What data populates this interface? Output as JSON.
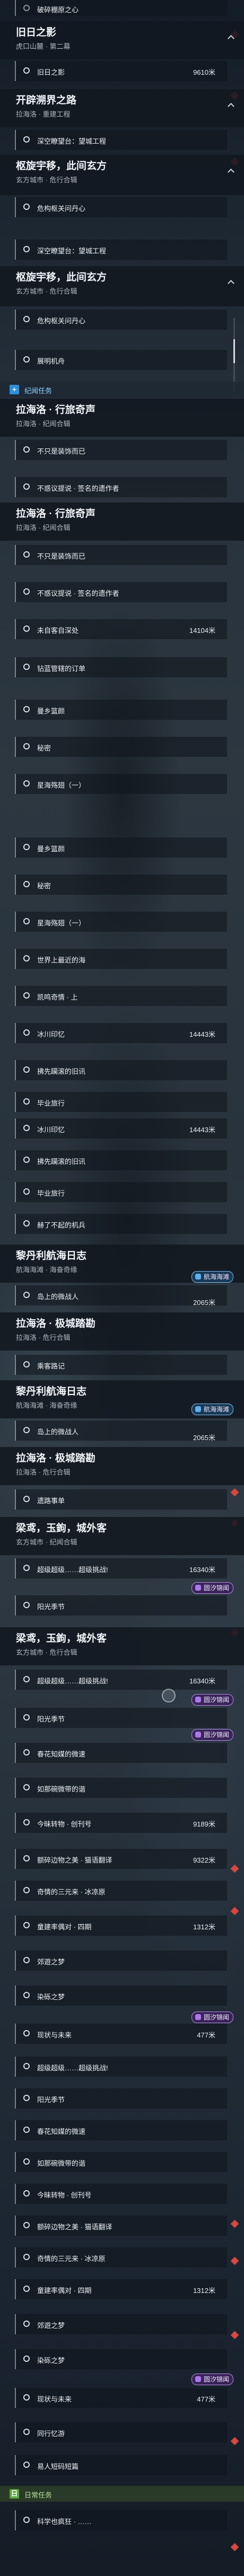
{
  "colors": {
    "accent_red": "#d9473f",
    "tag_blue": "#2e8fd8",
    "tag_green": "#59a43a",
    "badge_purple": "#b48be6"
  },
  "s1": {
    "item0": "破碎棚原之心"
  },
  "s2": {
    "title": "旧日之影",
    "sub": "虎口山麓 · 第二幕",
    "item0": "旧日之影",
    "item0_dist": "9610米"
  },
  "s3": {
    "title": "开辟溯界之路",
    "sub": "拉海洛 · 重建工程",
    "item0": "深空瞭望台：望城工程"
  },
  "s4": {
    "title": "枢旋宇移，此间玄方",
    "sub": "玄方城市 · 危行合辑",
    "items": [
      "危构枢关问丹心",
      "深空瞭望台：望城工程"
    ]
  },
  "s5": {
    "title": "枢旋宇移，此间玄方",
    "sub": "玄方城市 · 危行合辑",
    "items": [
      "危构枢关问丹心",
      "展明机舟"
    ]
  },
  "tag1": {
    "label": "纪闻任务",
    "icon": "+"
  },
  "s6": {
    "title": "拉海洛 · 行旅奇声",
    "sub": "拉海洛 · 纪闻合辑",
    "items": [
      "不只是装饰而已",
      "不惑议提说 · 签名的遗作者"
    ]
  },
  "s7": {
    "title": "拉海洛 · 行旅奇声",
    "sub": "拉海洛 · 纪闻合辑",
    "items": [
      "不只是装饰而已",
      "不惑议提说 · 签名的遗作者",
      "未自客自深处",
      "钻蓝管辖的订单",
      "曼乡篮颜",
      "秘密",
      "星海殇翅（一）",
      "曼乡篮颜",
      "秘密",
      "星海殇翅（一）",
      "世界上最近的海",
      "凯鸣奇情 · 上",
      "冰川印忆",
      "拂先躏滚的旧讯",
      "毕业旅行"
    ],
    "dist_a": "14104米",
    "dist_b": "14443米"
  },
  "s8": {
    "items": [
      "冰川印忆",
      "拂先躏滚的旧讯",
      "毕业旅行",
      "赫了不起的机兵"
    ],
    "dist": "14443米"
  },
  "s9": {
    "title": "黎丹利航海日志",
    "sub": "航海海滩 · 海奋奇缘",
    "badge": "航海海滩",
    "item0": "岛上的微战人",
    "item0_dist": "2065米"
  },
  "s10": {
    "title": "拉海洛 · 极城踏勘",
    "sub": "拉海洛 · 危行合辑",
    "item0": "乘客路记"
  },
  "s11": {
    "title": "黎丹利航海日志",
    "sub": "航海海滩 · 海奋奇缘",
    "badge": "航海海滩",
    "item0": "岛上的微战人",
    "item0_dist": "2065米"
  },
  "s12": {
    "title": "拉海洛 · 极城踏勘",
    "sub": "拉海洛 · 危行合辑",
    "item0": "遗路事单"
  },
  "s13": {
    "title": "梁鸢，玉鉤，城外客",
    "sub": "玄方城市 · 纪闻合辑",
    "items": [
      "超级超级……超级挑战!",
      "阳光季节"
    ],
    "dist": "16340米",
    "badge": "圆汐锦闻"
  },
  "s14": {
    "title": "梁鸢，玉鉤，城外客",
    "sub": "玄方城市 · 危行合辑",
    "items": [
      "超级超级……超级挑战!",
      "阳光季节",
      "春花知媒的微速",
      "如那碗微带的谐",
      "今昧转物 · 创刊号",
      "额碎边物之美 · 猫语翻译",
      "奇情的三元来 · 冰凉原",
      "童建率偶对 · 四期",
      "郊遊之梦",
      "染砾之梦",
      "现状与未来",
      "超级超级……超级挑战!",
      "阳光季节",
      "春花知媒的微速",
      "如那碗微带的谐",
      "今昧转物 · 创刊号",
      "额碎边物之美 · 猫语翻译",
      "奇情的三元来 · 冰凉原",
      "童建率偶对 · 四期",
      "郊遊之梦",
      "染砾之梦",
      "现状与未来",
      "同行忆游",
      "易人短码短篇"
    ],
    "dists": [
      "16340米",
      "9189米",
      "9322米",
      "1312米",
      "477米"
    ],
    "badges": [
      "圆汐锦闻",
      "圆汐锦闻",
      "圆汐锦闻",
      "圆汐锦闻"
    ]
  },
  "tag2": {
    "label": "日常任务",
    "icon": "日"
  },
  "s15": {
    "item0": "科学也疯狂 · ……"
  }
}
